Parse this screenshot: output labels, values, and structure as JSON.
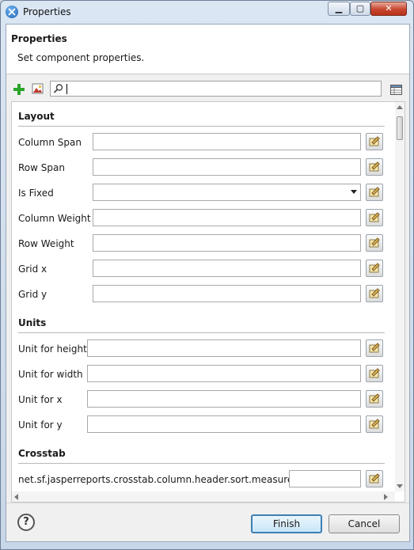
{
  "window": {
    "title": "Properties",
    "controls": {
      "minimize": "▁",
      "maximize": "▢",
      "close": "✕"
    },
    "accent": "#3c7fb1",
    "close_color": "#c8462f"
  },
  "header": {
    "title": "Properties",
    "description": "Set component properties."
  },
  "toolbar": {
    "add_icon": "plus-icon",
    "image_icon": "image-icon",
    "search": {
      "value": "",
      "placeholder": ""
    },
    "layout_toggle_icon": "table-layout-icon"
  },
  "sections": {
    "layout": {
      "title": "Layout",
      "rows": [
        {
          "label": "Column Span",
          "value": ""
        },
        {
          "label": "Row Span",
          "value": ""
        },
        {
          "label": "Is Fixed",
          "value": ""
        },
        {
          "label": "Column Weight",
          "value": ""
        },
        {
          "label": "Row Weight",
          "value": ""
        },
        {
          "label": "Grid x",
          "value": ""
        },
        {
          "label": "Grid y",
          "value": ""
        }
      ]
    },
    "units": {
      "title": "Units",
      "rows": [
        {
          "label": "Unit for height",
          "value": ""
        },
        {
          "label": "Unit for width",
          "value": ""
        },
        {
          "label": "Unit for x",
          "value": ""
        },
        {
          "label": "Unit for y",
          "value": ""
        }
      ]
    },
    "crosstab": {
      "title": "Crosstab",
      "rows": [
        {
          "label": "net.sf.jasperreports.crosstab.column.header.sort.measure.index",
          "value": ""
        }
      ]
    }
  },
  "footer": {
    "help": "?",
    "finish": "Finish",
    "cancel": "Cancel"
  }
}
